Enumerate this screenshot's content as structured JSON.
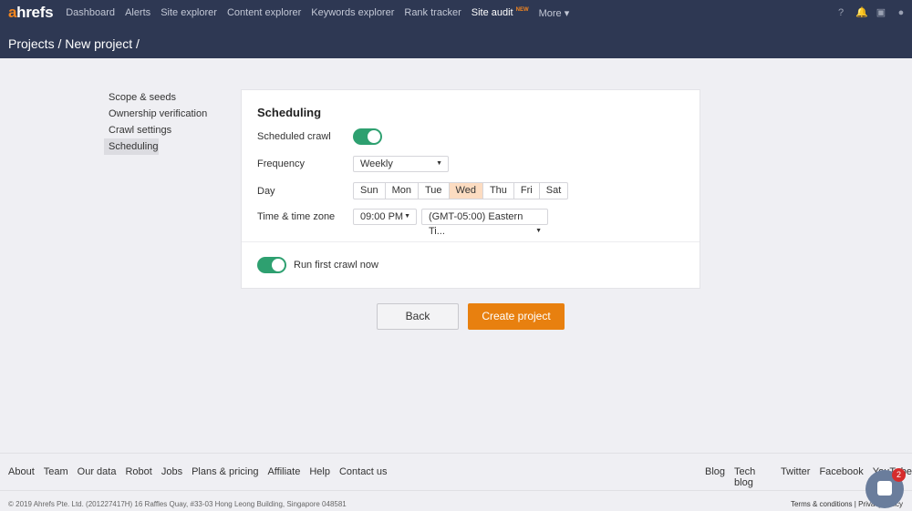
{
  "nav": {
    "logo_a": "a",
    "logo_rest": "hrefs",
    "items": [
      "Dashboard",
      "Alerts",
      "Site explorer",
      "Content explorer",
      "Keywords explorer",
      "Rank tracker",
      "Site audit",
      "More ▾"
    ],
    "new_badge": "NEW"
  },
  "breadcrumb": "Projects / New project /",
  "sidebar": [
    "Scope & seeds",
    "Ownership verification",
    "Crawl settings",
    "Scheduling"
  ],
  "card": {
    "title": "Scheduling",
    "scheduled_crawl": "Scheduled crawl",
    "frequency_label": "Frequency",
    "frequency": "Weekly",
    "day_label": "Day",
    "days": [
      "Sun",
      "Mon",
      "Tue",
      "Wed",
      "Thu",
      "Fri",
      "Sat"
    ],
    "selected_day": "Wed",
    "time_label": "Time & time zone",
    "time": "09:00 PM",
    "timezone": "(GMT-05:00) Eastern Ti...",
    "run_first": "Run first crawl now"
  },
  "buttons": {
    "back": "Back",
    "create": "Create project"
  },
  "footer": {
    "left": [
      "About",
      "Team",
      "Our data",
      "Robot",
      "Jobs",
      "Plans & pricing",
      "Affiliate",
      "Help",
      "Contact us"
    ],
    "right": [
      "Blog",
      "Tech blog",
      "Twitter",
      "Facebook",
      "YouTube"
    ],
    "copyright": "© 2019 Ahrefs Pte. Ltd. (201227417H) 16 Raffles Quay, #33-03 Hong Leong Building, Singapore 048581",
    "terms": "Terms & conditions",
    "privacy": "Privacy policy"
  },
  "chat": {
    "badge": "2"
  }
}
